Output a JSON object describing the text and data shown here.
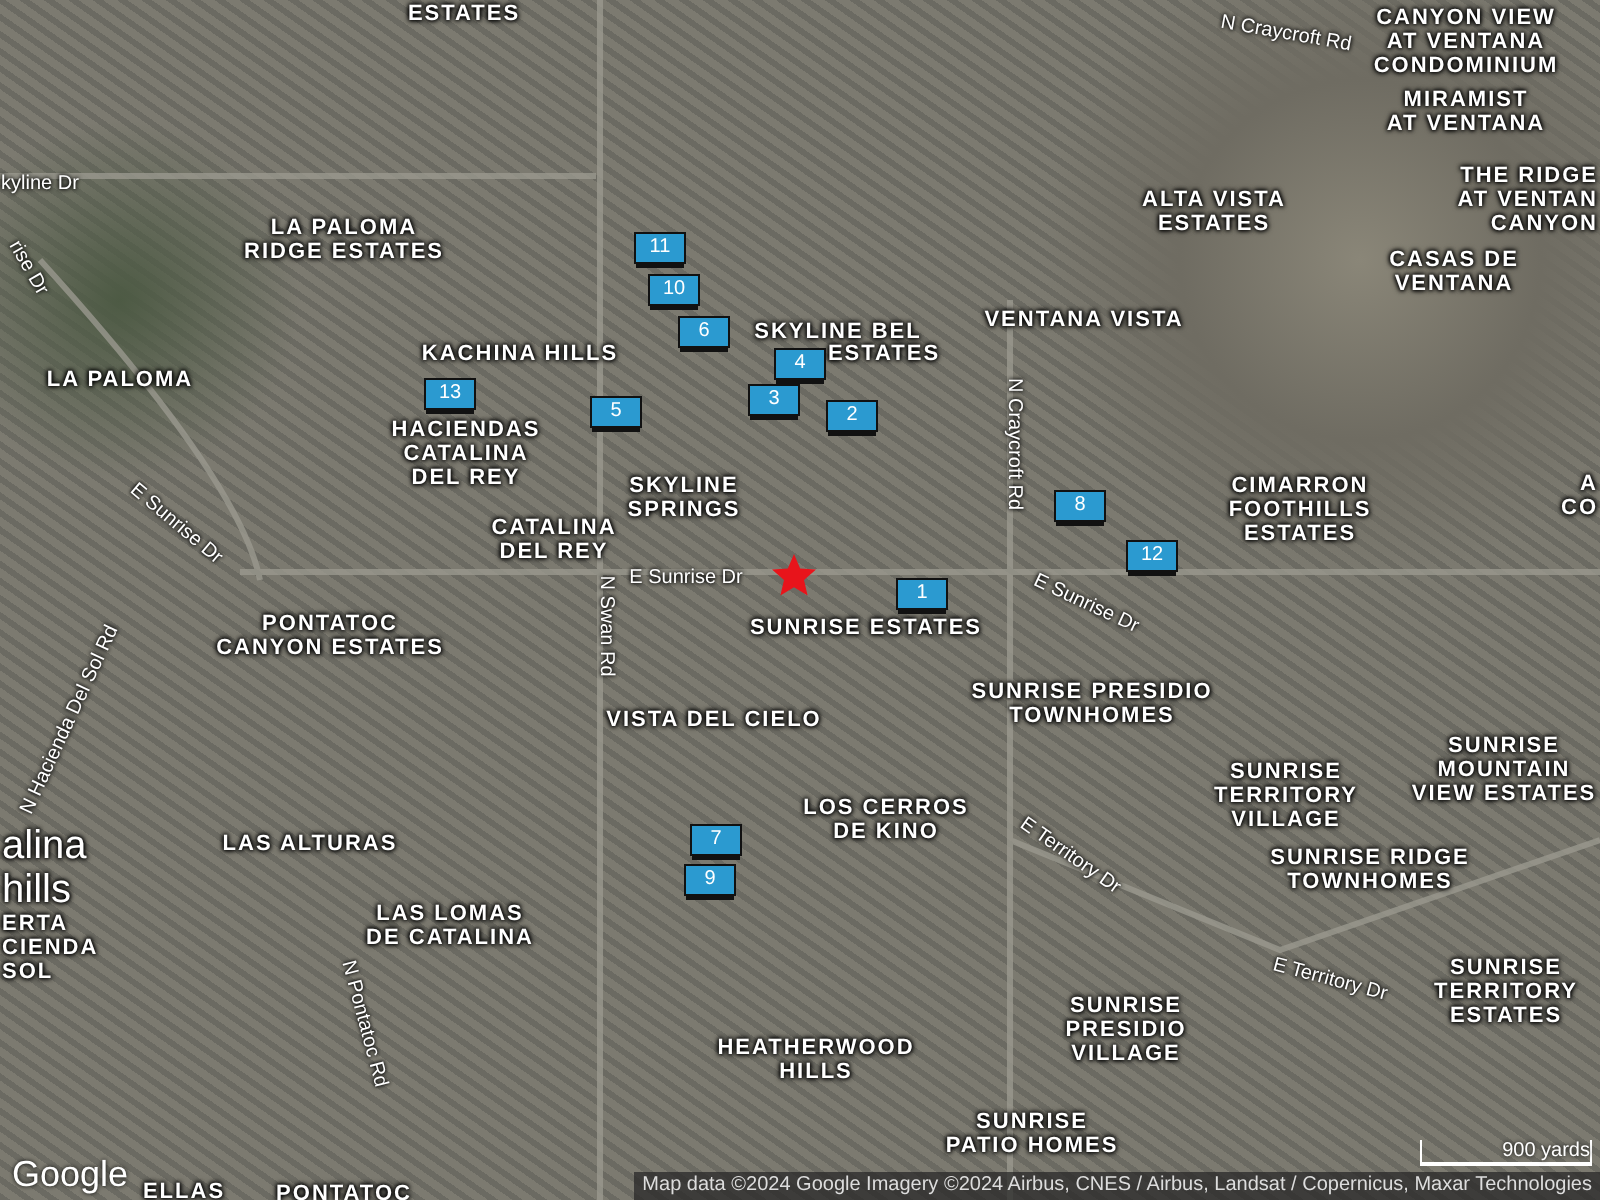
{
  "map": {
    "area_labels": [
      "ESTATES",
      "LA PALOMA\nRIDGE ESTATES",
      "LA PALOMA",
      "KACHINA HILLS",
      "HACIENDAS\nCATALINA\nDEL REY",
      "SKYLINE\nSPRINGS",
      "CATALINA\nDEL REY",
      "SKYLINE BEL",
      "ESTATES",
      "VENTANA VISTA",
      "ALTA VISTA\nESTATES",
      "CANYON VIEW\nAT VENTANA\nCONDOMINIUM",
      "MIRAMIST\nAT VENTANA",
      "THE RIDGE\nAT VENTAN\nCANYON",
      "CASAS DE\nVENTANA",
      "CIMARRON\nFOOTHILLS\nESTATES",
      "A\nCO",
      "PONTATOC\nCANYON ESTATES",
      "SUNRISE ESTATES",
      "VISTA DEL CIELO",
      "SUNRISE PRESIDIO\nTOWNHOMES",
      "LAS ALTURAS",
      "LAS LOMAS\nDE CATALINA",
      "LOS CERROS\nDE KINO",
      "SUNRISE\nTERRITORY\nVILLAGE",
      "SUNRISE RIDGE\nTOWNHOMES",
      "SUNRISE\nMOUNTAIN\nVIEW ESTATES",
      "SUNRISE\nTERRITORY\nESTATES",
      "SUNRISE\nPRESIDIO\nVILLAGE",
      "HEATHERWOOD\nHILLS",
      "SUNRISE\nPATIO HOMES",
      "alina\nhills",
      "ERTA\nCIENDA\nSOL",
      "PONTATOC",
      "ELLAS"
    ],
    "road_labels": [
      "kyline Dr",
      "rise Dr",
      "E Sunrise Dr",
      "E Sunrise Dr",
      "N Swan Rd",
      "N Craycroft Rd",
      "N Craycroft Rd",
      "E Sunrise Dr",
      "N Hacienda Del Sol Rd",
      "N Pontatoc Rd",
      "E Territory Dr",
      "E Territory Dr"
    ],
    "markers": [
      {
        "label": "1"
      },
      {
        "label": "2"
      },
      {
        "label": "3"
      },
      {
        "label": "4"
      },
      {
        "label": "5"
      },
      {
        "label": "6"
      },
      {
        "label": "7"
      },
      {
        "label": "8"
      },
      {
        "label": "9"
      },
      {
        "label": "10"
      },
      {
        "label": "11"
      },
      {
        "label": "12"
      },
      {
        "label": "13"
      }
    ],
    "logo": "Google",
    "attribution": "Map data ©2024 Google Imagery ©2024 Airbus, CNES / Airbus, Landsat / Copernicus, Maxar Technologies",
    "scale": "900 yards"
  }
}
